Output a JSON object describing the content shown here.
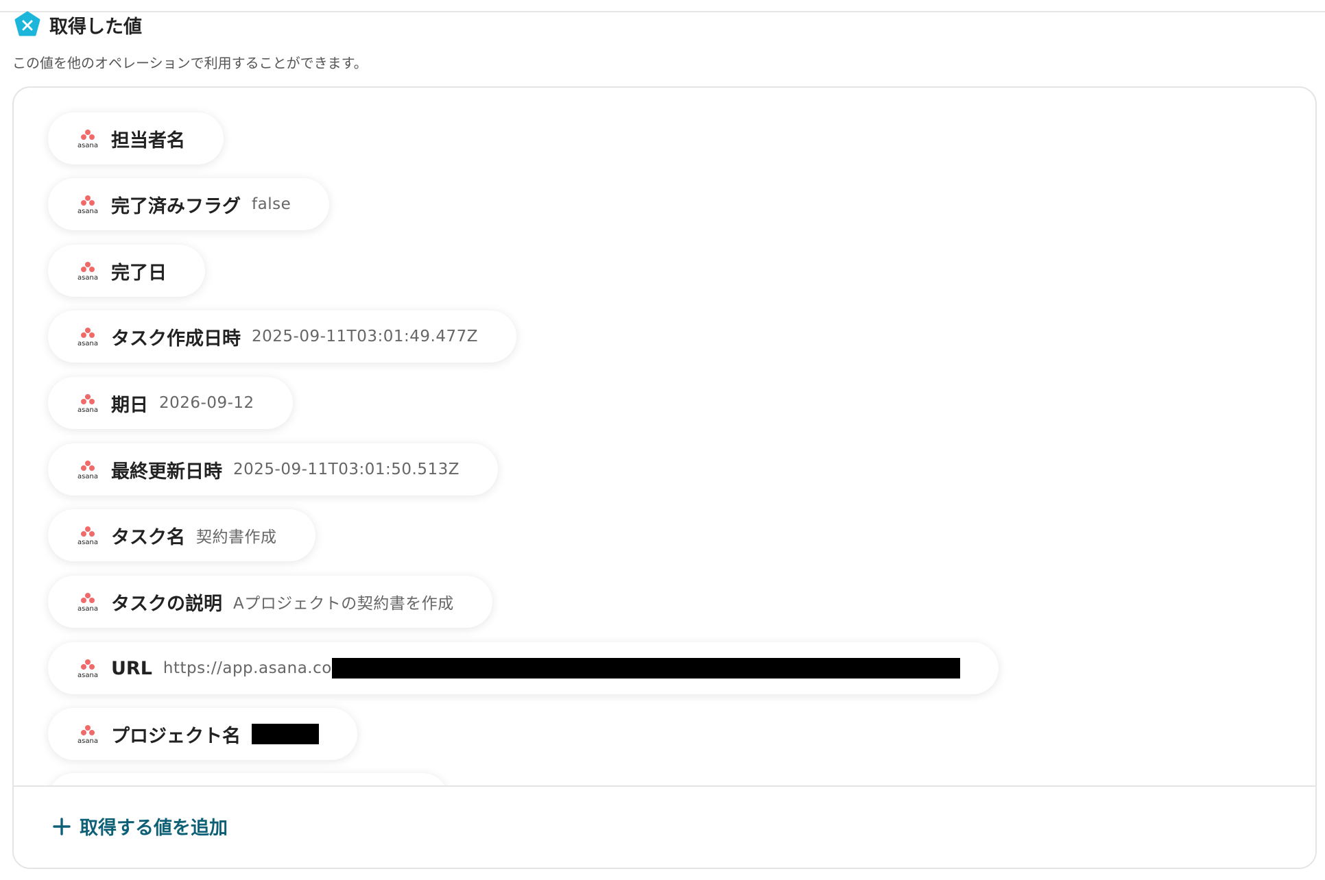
{
  "header": {
    "title": "取得した値",
    "subtitle": "この値を他のオペレーションで利用することができます。"
  },
  "colors": {
    "accent_teal": "#1bb6d9",
    "asana_coral": "#f06a6a",
    "link_dark_teal": "#0e6077"
  },
  "values": [
    {
      "label": "担当者名",
      "value": "",
      "icon": "asana-logo"
    },
    {
      "label": "完了済みフラグ",
      "value": "false",
      "icon": "asana-logo"
    },
    {
      "label": "完了日",
      "value": "",
      "icon": "asana-logo"
    },
    {
      "label": "タスク作成日時",
      "value": "2025-09-11T03:01:49.477Z",
      "icon": "asana-logo"
    },
    {
      "label": "期日",
      "value": "2026-09-12",
      "icon": "asana-logo"
    },
    {
      "label": "最終更新日時",
      "value": "2025-09-11T03:01:50.513Z",
      "icon": "asana-logo"
    },
    {
      "label": "タスク名",
      "value": "契約書作成",
      "icon": "asana-logo"
    },
    {
      "label": "タスクの説明",
      "value": "Aプロジェクトの契約書を作成",
      "icon": "asana-logo"
    },
    {
      "label": "URL",
      "value": "https://app.asana.co",
      "icon": "asana-logo",
      "redacted": true
    },
    {
      "label": "プロジェクト名",
      "value": "",
      "icon": "asana-logo",
      "redacted": true
    }
  ],
  "footer": {
    "add_label": "取得する値を追加",
    "icon": "plus-icon"
  }
}
